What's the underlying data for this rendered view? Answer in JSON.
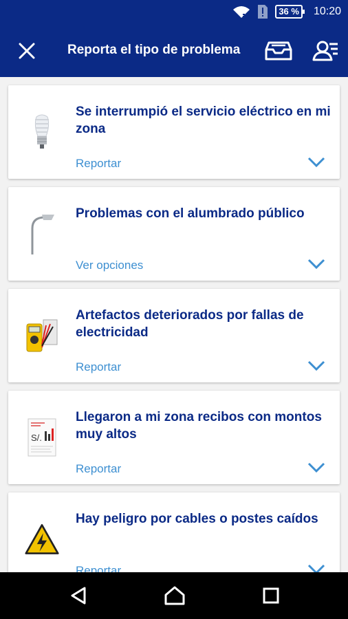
{
  "status_bar": {
    "battery": "36 %",
    "time": "10:20"
  },
  "app_bar": {
    "title": "Reporta el tipo de problema"
  },
  "cards": [
    {
      "title": "Se interrumpió el servicio eléctrico en mi zona",
      "action": "Reportar",
      "icon": "lightbulb-icon"
    },
    {
      "title": "Problemas con el alumbrado público",
      "action": "Ver opciones",
      "icon": "streetlight-icon"
    },
    {
      "title": "Artefactos deteriorados por fallas de electricidad",
      "action": "Reportar",
      "icon": "multimeter-icon"
    },
    {
      "title": "Llegaron a mi zona recibos con montos muy altos",
      "action": "Reportar",
      "icon": "bill-icon",
      "icon_text": "S/."
    },
    {
      "title": "Hay peligro por cables o postes caídos",
      "action": "Reportar",
      "icon": "electric-hazard-icon"
    }
  ],
  "colors": {
    "primary": "#0b2a86",
    "link": "#3d8fd1",
    "chevron": "#3d8fd1"
  }
}
